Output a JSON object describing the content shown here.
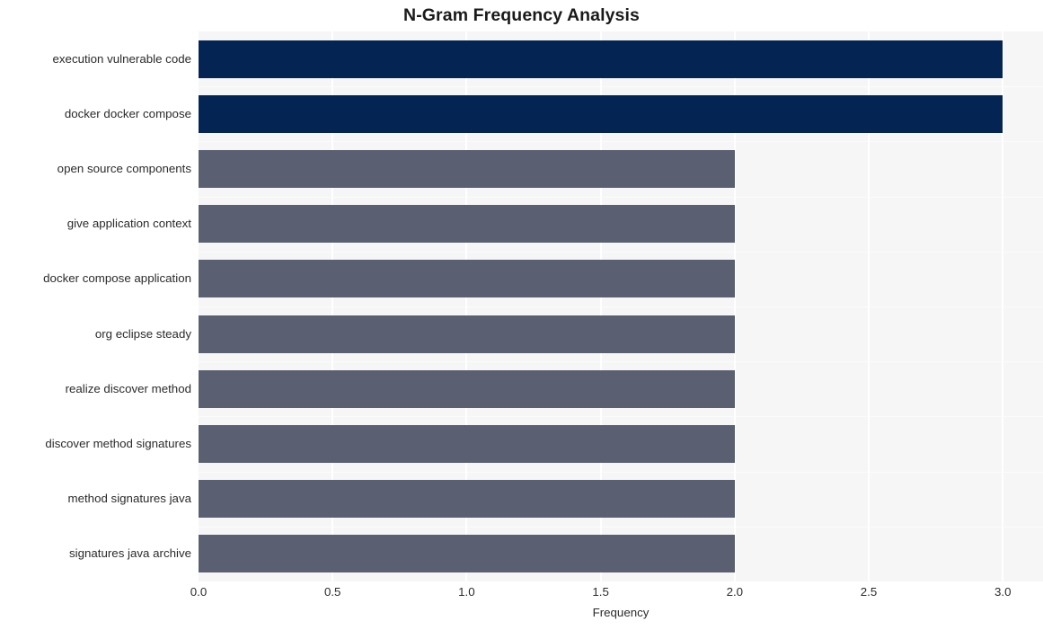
{
  "chart_data": {
    "type": "bar",
    "orientation": "horizontal",
    "title": "N-Gram Frequency Analysis",
    "xlabel": "Frequency",
    "ylabel": "",
    "xlim": [
      0,
      3.15
    ],
    "xticks": [
      "0.0",
      "0.5",
      "1.0",
      "1.5",
      "2.0",
      "2.5",
      "3.0"
    ],
    "xtick_values": [
      0,
      0.5,
      1,
      1.5,
      2,
      2.5,
      3
    ],
    "grid": true,
    "legend": null,
    "categories": [
      "execution vulnerable code",
      "docker docker compose",
      "open source components",
      "give application context",
      "docker compose application",
      "org eclipse steady",
      "realize discover method",
      "discover method signatures",
      "method signatures java",
      "signatures java archive"
    ],
    "values": [
      3,
      3,
      2,
      2,
      2,
      2,
      2,
      2,
      2,
      2
    ],
    "bar_colors": [
      "#042453",
      "#042453",
      "#5a6072",
      "#5a6072",
      "#5a6072",
      "#5a6072",
      "#5a6072",
      "#5a6072",
      "#5a6072",
      "#5a6072"
    ],
    "plot_background": "#f6f6f7",
    "gridline_color": "#ffffff",
    "figure_background": "#ffffff"
  }
}
